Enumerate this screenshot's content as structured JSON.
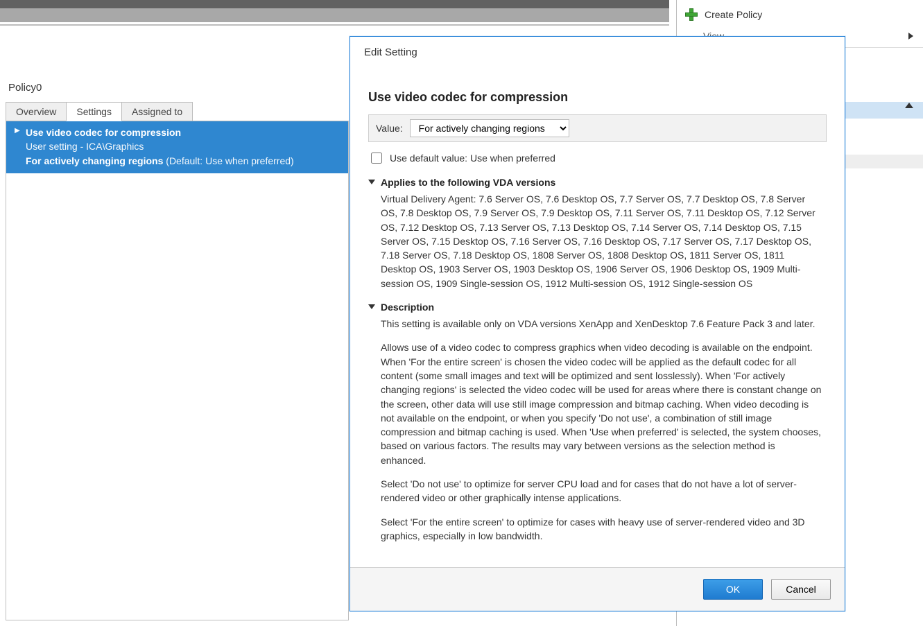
{
  "left": {
    "policy_name": "Policy0",
    "tabs": {
      "overview": "Overview",
      "settings": "Settings",
      "assigned_to": "Assigned to"
    },
    "setting": {
      "name": "Use video codec for compression",
      "path": "User setting - ICA\\Graphics",
      "value": "For actively changing regions",
      "default_prefix": " (Default: ",
      "default_value": "Use when preferred",
      "default_suffix": ")"
    }
  },
  "right": {
    "create_policy": "Create Policy",
    "view": "View"
  },
  "dialog": {
    "title": "Edit Setting",
    "heading": "Use video codec for compression",
    "value_label": "Value:",
    "value_selected": "For actively changing regions",
    "value_options": [
      "For actively changing regions",
      "For the entire screen",
      "Use when preferred",
      "Do not use"
    ],
    "use_default_label": "Use default value: Use when preferred",
    "sections": {
      "applies_head": "Applies to the following VDA versions",
      "applies_body": "Virtual Delivery Agent: 7.6 Server OS, 7.6 Desktop OS, 7.7 Server OS, 7.7 Desktop OS, 7.8 Server OS, 7.8 Desktop OS, 7.9 Server OS, 7.9 Desktop OS, 7.11 Server OS, 7.11 Desktop OS, 7.12 Server OS, 7.12 Desktop OS, 7.13 Server OS, 7.13 Desktop OS, 7.14 Server OS, 7.14 Desktop OS, 7.15 Server OS, 7.15 Desktop OS, 7.16 Server OS, 7.16 Desktop OS, 7.17 Server OS, 7.17 Desktop OS, 7.18 Server OS, 7.18 Desktop OS, 1808 Server OS, 1808 Desktop OS, 1811 Server OS, 1811 Desktop OS, 1903 Server OS, 1903 Desktop OS, 1906 Server OS, 1906 Desktop OS, 1909 Multi-session OS, 1909 Single-session OS, 1912 Multi-session OS, 1912 Single-session OS",
      "desc_head": "Description",
      "desc_p1": "This setting is available only on VDA versions XenApp and XenDesktop 7.6 Feature Pack 3 and later.",
      "desc_p2": "Allows use of a video codec to compress graphics when video decoding is available on the endpoint. When 'For the entire screen' is chosen the video codec will be applied as the default codec for all content (some small images and text will be optimized and sent losslessly). When 'For actively changing regions' is selected the video codec will be used for areas where there is constant change on the screen, other data will use still image compression and bitmap caching. When video decoding is not available on the endpoint, or when you specify 'Do not use', a combination of still image compression and bitmap caching is used. When 'Use when preferred' is selected, the system chooses, based on various factors. The results may vary between versions as the selection method is enhanced.",
      "desc_p3": "Select 'Do not use' to optimize for server CPU load and for cases that do not have a lot of server-rendered video or other graphically intense applications.",
      "desc_p4": "Select 'For the entire screen' to optimize for cases with heavy use of server-rendered video and 3D graphics, especially in low bandwidth."
    },
    "buttons": {
      "ok": "OK",
      "cancel": "Cancel"
    }
  }
}
